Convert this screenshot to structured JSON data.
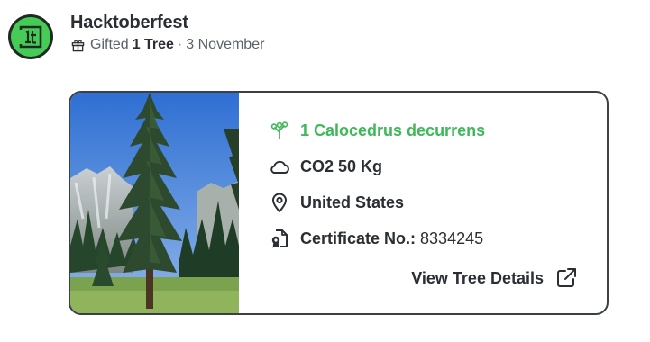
{
  "header": {
    "org_name": "Hacktoberfest",
    "gift_prefix": "Gifted",
    "gift_amount": "1 Tree",
    "separator": "·",
    "date": "3 November",
    "avatar_icon": "hacktoberfest-logo-icon",
    "gift_icon": "gift-icon"
  },
  "card": {
    "photo": "tree-photo",
    "species": {
      "icon": "sapling-icon",
      "label": "1 Calocedrus decurrens"
    },
    "co2": {
      "icon": "cloud-icon",
      "label": "CO2 50 Kg"
    },
    "location": {
      "icon": "map-pin-icon",
      "label": "United States"
    },
    "certificate": {
      "icon": "certificate-icon",
      "label": "Certificate No.:",
      "number": "8334245"
    },
    "view_link": {
      "label": "View Tree Details",
      "icon": "external-link-icon"
    }
  },
  "colors": {
    "accent_green": "#3fb85a",
    "avatar_green": "#46cc56",
    "border": "#3b4046",
    "text": "#2b2f33",
    "muted": "#5b6168"
  }
}
